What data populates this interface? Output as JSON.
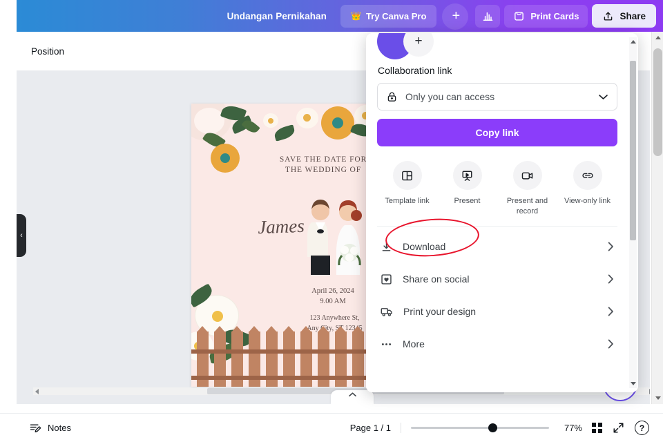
{
  "header": {
    "doc_title": "Undangan Pernikahan",
    "pro_button": "Try Canva Pro",
    "crown_icon": "crown-icon",
    "add_icon": "plus-icon",
    "insights_icon": "bar-chart-icon",
    "print_cards": "Print Cards",
    "print_cards_icon": "envelope-icon",
    "share": "Share",
    "share_icon": "upload-icon",
    "gradient_start": "#2b8bd6",
    "gradient_end": "#8d3bf2"
  },
  "toolbar": {
    "position_label": "Position"
  },
  "sidebar": {
    "collapse_icon": "chevron-left-icon"
  },
  "canvas": {
    "save_the_date": "SAVE THE DATE FOR\nTHE WEDDING OF",
    "name": "James",
    "date": "April 26, 2024\n9.00 AM",
    "address": "123 Anywhere St,\nAny City, ST 12345",
    "background_color": "#fbe9e6",
    "fence_color": "#c08463"
  },
  "share_panel": {
    "avatar_name": "avatar",
    "invite_icon": "plus-icon",
    "collaboration_title": "Collaboration link",
    "access_value": "Only you can access",
    "access_icon": "lock-icon",
    "access_chevron": "chevron-down-icon",
    "copy_link": "Copy link",
    "quick_actions": [
      {
        "label": "Template link",
        "icon": "template-link-icon"
      },
      {
        "label": "Present",
        "icon": "present-icon"
      },
      {
        "label": "Present and record",
        "icon": "video-camera-icon"
      },
      {
        "label": "View-only link",
        "icon": "link-icon"
      }
    ],
    "menu_items": [
      {
        "label": "Download",
        "icon": "download-icon",
        "chevron": "chevron-right-icon",
        "annotated": true
      },
      {
        "label": "Share on social",
        "icon": "heart-square-icon",
        "chevron": "chevron-right-icon",
        "annotated": false
      },
      {
        "label": "Print your design",
        "icon": "delivery-truck-icon",
        "chevron": "chevron-right-icon",
        "annotated": false
      },
      {
        "label": "More",
        "icon": "ellipsis-icon",
        "chevron": "chevron-right-icon",
        "annotated": false
      }
    ],
    "annotation_color": "#e8142c",
    "primary_color": "#8b3dfa"
  },
  "footer": {
    "notes": "Notes",
    "notes_icon": "notes-icon",
    "page_indicator": "Page 1 / 1",
    "zoom_value": "77%",
    "grid_icon": "grid-view-icon",
    "expand_icon": "expand-icon",
    "help_icon": "help-icon",
    "page_tab_icon": "chevron-up-icon"
  }
}
